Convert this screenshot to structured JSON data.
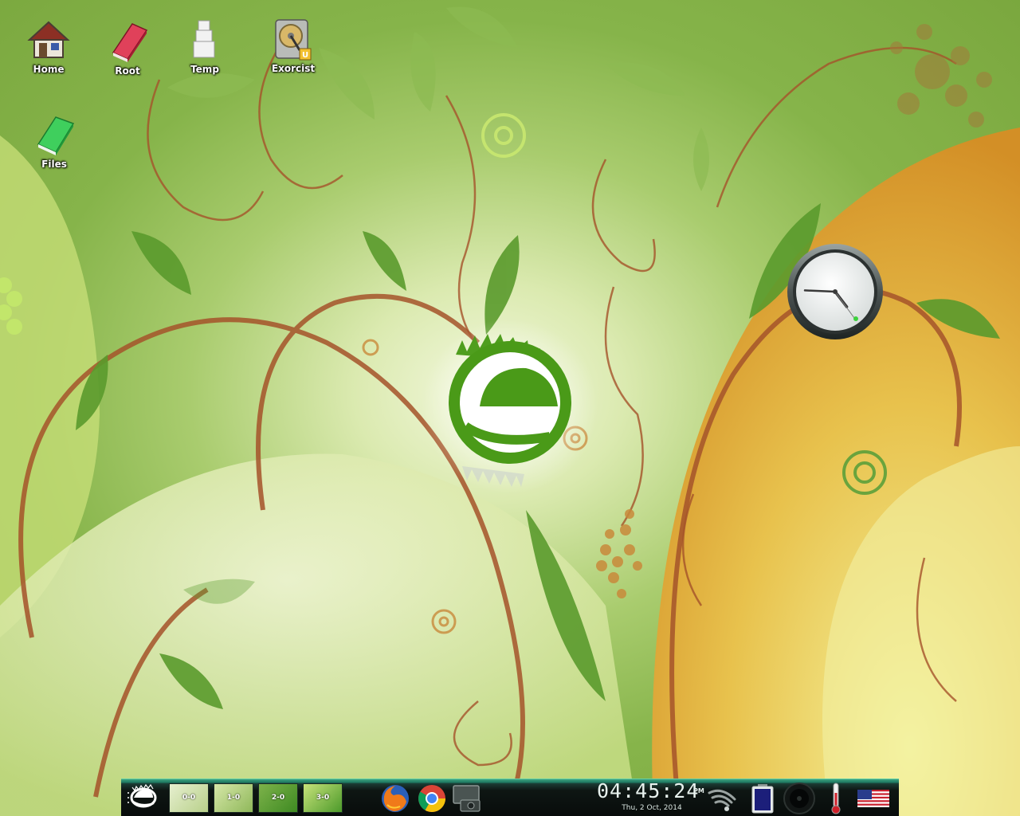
{
  "desktop": {
    "icons": [
      {
        "label": "Home",
        "icon": "home-folder-icon"
      },
      {
        "label": "Root",
        "icon": "root-book-icon"
      },
      {
        "label": "Temp",
        "icon": "temp-boxes-icon"
      },
      {
        "label": "Exorcist",
        "icon": "hard-drive-icon"
      },
      {
        "label": "Files",
        "icon": "files-book-icon"
      }
    ]
  },
  "clock_gadget": {
    "icon": "analog-clock-icon",
    "hour": 4,
    "minute": 45,
    "second": 24
  },
  "shelf": {
    "start_icon": "enlightenment-logo-icon",
    "pager": [
      {
        "label": "0-0",
        "active": true
      },
      {
        "label": "1-0",
        "active": false
      },
      {
        "label": "2-0",
        "active": false
      },
      {
        "label": "3-0",
        "active": false
      }
    ],
    "launchers": [
      {
        "icon": "firefox-icon",
        "name": "Firefox"
      },
      {
        "icon": "chrome-icon",
        "name": "Chrome"
      },
      {
        "icon": "screenshot-camera-icon",
        "name": "Screenshot"
      }
    ],
    "clock": {
      "time": "04:45:24",
      "ampm": "PM",
      "date": "Thu,  2 Oct, 2014"
    },
    "gadgets": [
      {
        "icon": "wifi-signal-icon"
      },
      {
        "icon": "battery-icon"
      },
      {
        "icon": "volume-speaker-icon"
      },
      {
        "icon": "temperature-thermometer-icon"
      },
      {
        "icon": "us-flag-keyboard-icon"
      }
    ]
  },
  "colors": {
    "accent": "#3da07d",
    "wallpaper_green": "#86b44a",
    "wallpaper_orange": "#e0a030",
    "vine_brown": "#a5532a"
  }
}
